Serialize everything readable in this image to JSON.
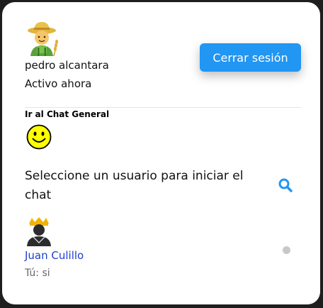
{
  "user": {
    "name": "pedro alcantara",
    "status": "Activo ahora",
    "avatar_icon": "farmer-avatar-icon"
  },
  "header": {
    "logout_label": "Cerrar sesión",
    "accent_color": "#2196f3"
  },
  "general_chat": {
    "link_label": "Ir al Chat General",
    "icon": "smiley-face-icon"
  },
  "search": {
    "prompt": "Seleccione un usuario para iniciar el chat",
    "icon": "search-icon"
  },
  "chats": [
    {
      "name": "Juan Culillo",
      "last_message": "Tú: si",
      "online": false,
      "avatar_icon": "crowned-person-avatar-icon"
    }
  ]
}
